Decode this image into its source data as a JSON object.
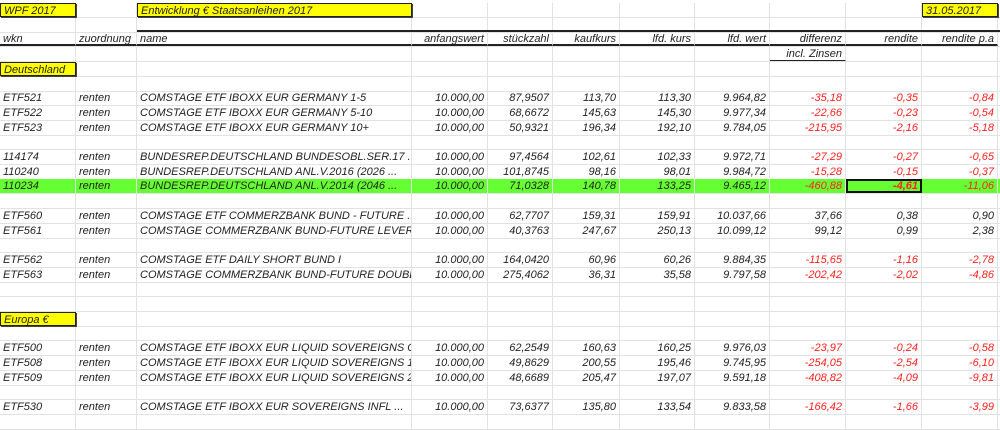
{
  "top": {
    "wpf": "WPF 2017",
    "title": "Entwicklung € Staatsanleihen 2017",
    "date": "31.05.2017"
  },
  "columns": [
    "wkn",
    "zuordnung",
    "name",
    "anfangswert",
    "stückzahl",
    "kaufkurs",
    "lfd. kurs",
    "lfd. wert",
    "differenz",
    "rendite",
    "rendite p.a"
  ],
  "subheader": "incl. Zinsen",
  "sections": {
    "de": "Deutschland",
    "eu": "Europa €"
  },
  "rows": [
    {
      "wkn": "ETF521",
      "z": "renten",
      "name": "COMSTAGE ETF IBOXX EUR GERMANY 1-5",
      "a": "10.000,00",
      "s": "87,9507",
      "k": "113,70",
      "lk": "113,30",
      "lw": "9.964,82",
      "d": "-35,18",
      "r": "-0,35",
      "rpa": "-0,84"
    },
    {
      "wkn": "ETF522",
      "z": "renten",
      "name": "COMSTAGE ETF IBOXX EUR GERMANY 5-10",
      "a": "10.000,00",
      "s": "68,6672",
      "k": "145,63",
      "lk": "145,30",
      "lw": "9.977,34",
      "d": "-22,66",
      "r": "-0,23",
      "rpa": "-0,54"
    },
    {
      "wkn": "ETF523",
      "z": "renten",
      "name": "COMSTAGE ETF IBOXX EUR GERMANY 10+",
      "a": "10.000,00",
      "s": "50,9321",
      "k": "196,34",
      "lk": "192,10",
      "lw": "9.784,05",
      "d": "-215,95",
      "r": "-2,16",
      "rpa": "-5,18"
    },
    {
      "wkn": "114174",
      "z": "renten",
      "name": "BUNDESREP.DEUTSCHLAND BUNDESOBL.SER.17 ...",
      "a": "10.000,00",
      "s": "97,4564",
      "k": "102,61",
      "lk": "102,33",
      "lw": "9.972,71",
      "d": "-27,29",
      "r": "-0,27",
      "rpa": "-0,65"
    },
    {
      "wkn": "110240",
      "z": "renten",
      "name": "BUNDESREP.DEUTSCHLAND ANL.V.2016 (2026 ...",
      "a": "10.000,00",
      "s": "101,8745",
      "k": "98,16",
      "lk": "98,01",
      "lw": "9.984,72",
      "d": "-15,28",
      "r": "-0,15",
      "rpa": "-0,37"
    },
    {
      "wkn": "110234",
      "z": "renten",
      "name": "BUNDESREP.DEUTSCHLAND ANL.V.2014 (2046 ...",
      "a": "10.000,00",
      "s": "71,0328",
      "k": "140,78",
      "lk": "133,25",
      "lw": "9.465,12",
      "d": "-460,88",
      "r": "-4,61",
      "rpa": "-11,06",
      "highlight": true,
      "highlight_color": "#66ff33"
    },
    {
      "wkn": "ETF560",
      "z": "renten",
      "name": "COMSTAGE ETF COMMERZBANK BUND - FUTURE ...",
      "a": "10.000,00",
      "s": "62,7707",
      "k": "159,31",
      "lk": "159,91",
      "lw": "10.037,66",
      "d": "37,66",
      "r": "0,38",
      "rpa": "0,90"
    },
    {
      "wkn": "ETF561",
      "z": "renten",
      "name": "COMSTAGE COMMERZBANK BUND-FUTURE LEVER ...",
      "a": "10.000,00",
      "s": "40,3763",
      "k": "247,67",
      "lk": "250,13",
      "lw": "10.099,12",
      "d": "99,12",
      "r": "0,99",
      "rpa": "2,38"
    },
    {
      "wkn": "ETF562",
      "z": "renten",
      "name": "COMSTAGE ETF DAILY SHORT BUND I",
      "a": "10.000,00",
      "s": "164,0420",
      "k": "60,96",
      "lk": "60,26",
      "lw": "9.884,35",
      "d": "-115,65",
      "r": "-1,16",
      "rpa": "-2,78"
    },
    {
      "wkn": "ETF563",
      "z": "renten",
      "name": "COMSTAGE COMMERZBANK BUND-FUTURE DOUBL ...",
      "a": "10.000,00",
      "s": "275,4062",
      "k": "36,31",
      "lk": "35,58",
      "lw": "9.797,58",
      "d": "-202,42",
      "r": "-2,02",
      "rpa": "-4,86"
    },
    {
      "wkn": "ETF500",
      "z": "renten",
      "name": "COMSTAGE ETF IBOXX EUR LIQUID SOVEREIGNS OVER",
      "a": "10.000,00",
      "s": "62,2549",
      "k": "160,63",
      "lk": "160,25",
      "lw": "9.976,03",
      "d": "-23,97",
      "r": "-0,24",
      "rpa": "-0,58"
    },
    {
      "wkn": "ETF508",
      "z": "renten",
      "name": "COMSTAGE ETF IBOXX EUR LIQUID SOVEREIGNS 15+",
      "a": "10.000,00",
      "s": "49,8629",
      "k": "200,55",
      "lk": "195,46",
      "lw": "9.745,95",
      "d": "-254,05",
      "r": "-2,54",
      "rpa": "-6,10"
    },
    {
      "wkn": "ETF509",
      "z": "renten",
      "name": "COMSTAGE ETF IBOXX EUR LIQUID SOVEREIGNS 25+ ...",
      "a": "10.000,00",
      "s": "48,6689",
      "k": "205,47",
      "lk": "197,07",
      "lw": "9.591,18",
      "d": "-408,82",
      "r": "-4,09",
      "rpa": "-9,81"
    },
    {
      "wkn": "ETF530",
      "z": "renten",
      "name": "COMSTAGE ETF IBOXX EUR SOVEREIGNS INFL ...",
      "a": "10.000,00",
      "s": "73,6377",
      "k": "135,80",
      "lk": "133,54",
      "lw": "9.833,58",
      "d": "-166,42",
      "r": "-1,66",
      "rpa": "-3,99"
    }
  ],
  "colors": {
    "negative": "#ff2020",
    "label_fill": "#ffff00",
    "highlight": "#66ff33"
  }
}
